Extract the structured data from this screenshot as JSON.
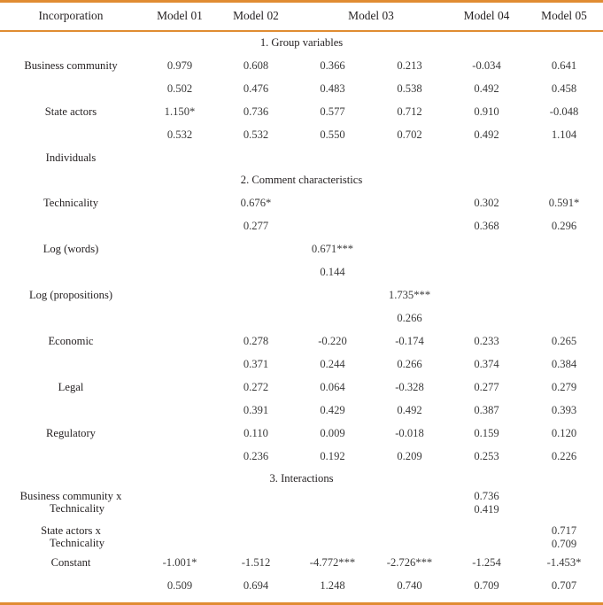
{
  "table": {
    "header": {
      "label_col": "Incorporation",
      "models": [
        "Model 01",
        "Model 02",
        "Model 03",
        "Model 04",
        "Model 05"
      ]
    },
    "accent_color": "#E08C32",
    "sections": [
      {
        "title": "1. Group variables"
      },
      {
        "title": "2. Comment characteristics"
      },
      {
        "title": "3. Interactions"
      }
    ],
    "rows": {
      "business_community": {
        "label": "Business community",
        "coef": [
          "0.979",
          "0.608",
          "0.366",
          "0.213",
          "-0.034",
          "0.641"
        ],
        "se": [
          "0.502",
          "0.476",
          "0.483",
          "0.538",
          "0.492",
          "0.458"
        ]
      },
      "state_actors": {
        "label": "State actors",
        "coef": [
          "1.150*",
          "0.736",
          "0.577",
          "0.712",
          "0.910",
          "-0.048"
        ],
        "se": [
          "0.532",
          "0.532",
          "0.550",
          "0.702",
          "0.492",
          "1.104"
        ]
      },
      "individuals": {
        "label": "Individuals",
        "coef": [
          "",
          "",
          "",
          "",
          "",
          ""
        ],
        "se": [
          "",
          "",
          "",
          "",
          "",
          ""
        ]
      },
      "technicality": {
        "label": "Technicality",
        "coef": [
          "",
          "0.676*",
          "",
          "",
          "0.302",
          "0.591*"
        ],
        "se": [
          "",
          "0.277",
          "",
          "",
          "0.368",
          "0.296"
        ]
      },
      "log_words": {
        "label": "Log (words)",
        "coef": [
          "",
          "",
          "0.671***",
          "",
          "",
          ""
        ],
        "se": [
          "",
          "",
          "0.144",
          "",
          "",
          ""
        ]
      },
      "log_propositions": {
        "label": "Log (propositions)",
        "coef": [
          "",
          "",
          "",
          "1.735***",
          "",
          ""
        ],
        "se": [
          "",
          "",
          "",
          "0.266",
          "",
          ""
        ]
      },
      "economic": {
        "label": "Economic",
        "coef": [
          "",
          "0.278",
          "-0.220",
          "-0.174",
          "0.233",
          "0.265"
        ],
        "se": [
          "",
          "0.371",
          "0.244",
          "0.266",
          "0.374",
          "0.384"
        ]
      },
      "legal": {
        "label": "Legal",
        "coef": [
          "",
          "0.272",
          "0.064",
          "-0.328",
          "0.277",
          "0.279"
        ],
        "se": [
          "",
          "0.391",
          "0.429",
          "0.492",
          "0.387",
          "0.393"
        ]
      },
      "regulatory": {
        "label": "Regulatory",
        "coef": [
          "",
          "0.110",
          "0.009",
          "-0.018",
          "0.159",
          "0.120"
        ],
        "se": [
          "",
          "0.236",
          "0.192",
          "0.209",
          "0.253",
          "0.226"
        ]
      },
      "bc_x_tech": {
        "label_line1": "Business community x",
        "label_line2": "Technicality",
        "coef": [
          "",
          "",
          "",
          "",
          "0.736",
          ""
        ],
        "se": [
          "",
          "",
          "",
          "",
          "0.419",
          ""
        ]
      },
      "sa_x_tech": {
        "label_line1": "State actors x",
        "label_line2": "Technicality",
        "coef": [
          "",
          "",
          "",
          "",
          "",
          "0.717"
        ],
        "se": [
          "",
          "",
          "",
          "",
          "",
          "0.709"
        ]
      },
      "constant": {
        "label": "Constant",
        "coef": [
          "-1.001*",
          "-1.512",
          "-4.772***",
          "-2.726***",
          "-1.254",
          "-1.453*"
        ],
        "se": [
          "0.509",
          "0.694",
          "1.248",
          "0.740",
          "0.709",
          "0.707"
        ]
      }
    }
  }
}
